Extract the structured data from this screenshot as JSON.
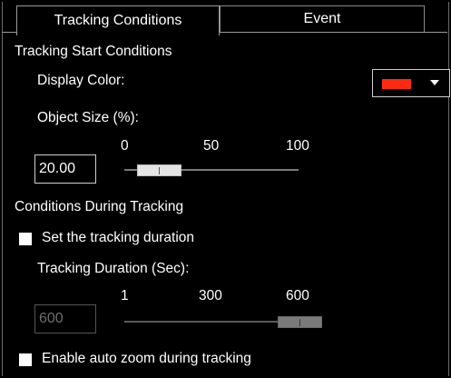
{
  "tabs": [
    {
      "label": "Tracking Conditions",
      "active": true
    },
    {
      "label": "Event",
      "active": false
    }
  ],
  "start_conditions": {
    "heading": "Tracking Start Conditions",
    "display_color_label": "Display Color:",
    "display_color_value": "#ff2a10",
    "object_size_label": "Object Size (%):",
    "object_size_value": "20.00",
    "slider": {
      "ticks": [
        "0",
        "50",
        "100"
      ],
      "min": 0,
      "max": 100,
      "value": 20
    }
  },
  "during_tracking": {
    "heading": "Conditions During Tracking",
    "set_duration_label": "Set the tracking duration",
    "set_duration_checked": false,
    "duration_label": "Tracking Duration (Sec):",
    "duration_value": "600",
    "duration_enabled": false,
    "slider": {
      "ticks": [
        "1",
        "300",
        "600"
      ],
      "min": 1,
      "max": 600,
      "value": 600
    },
    "auto_zoom_label": "Enable auto zoom during tracking",
    "auto_zoom_checked": false
  },
  "colors": {
    "background": "#000000",
    "accent_red": "#ff2a10"
  }
}
